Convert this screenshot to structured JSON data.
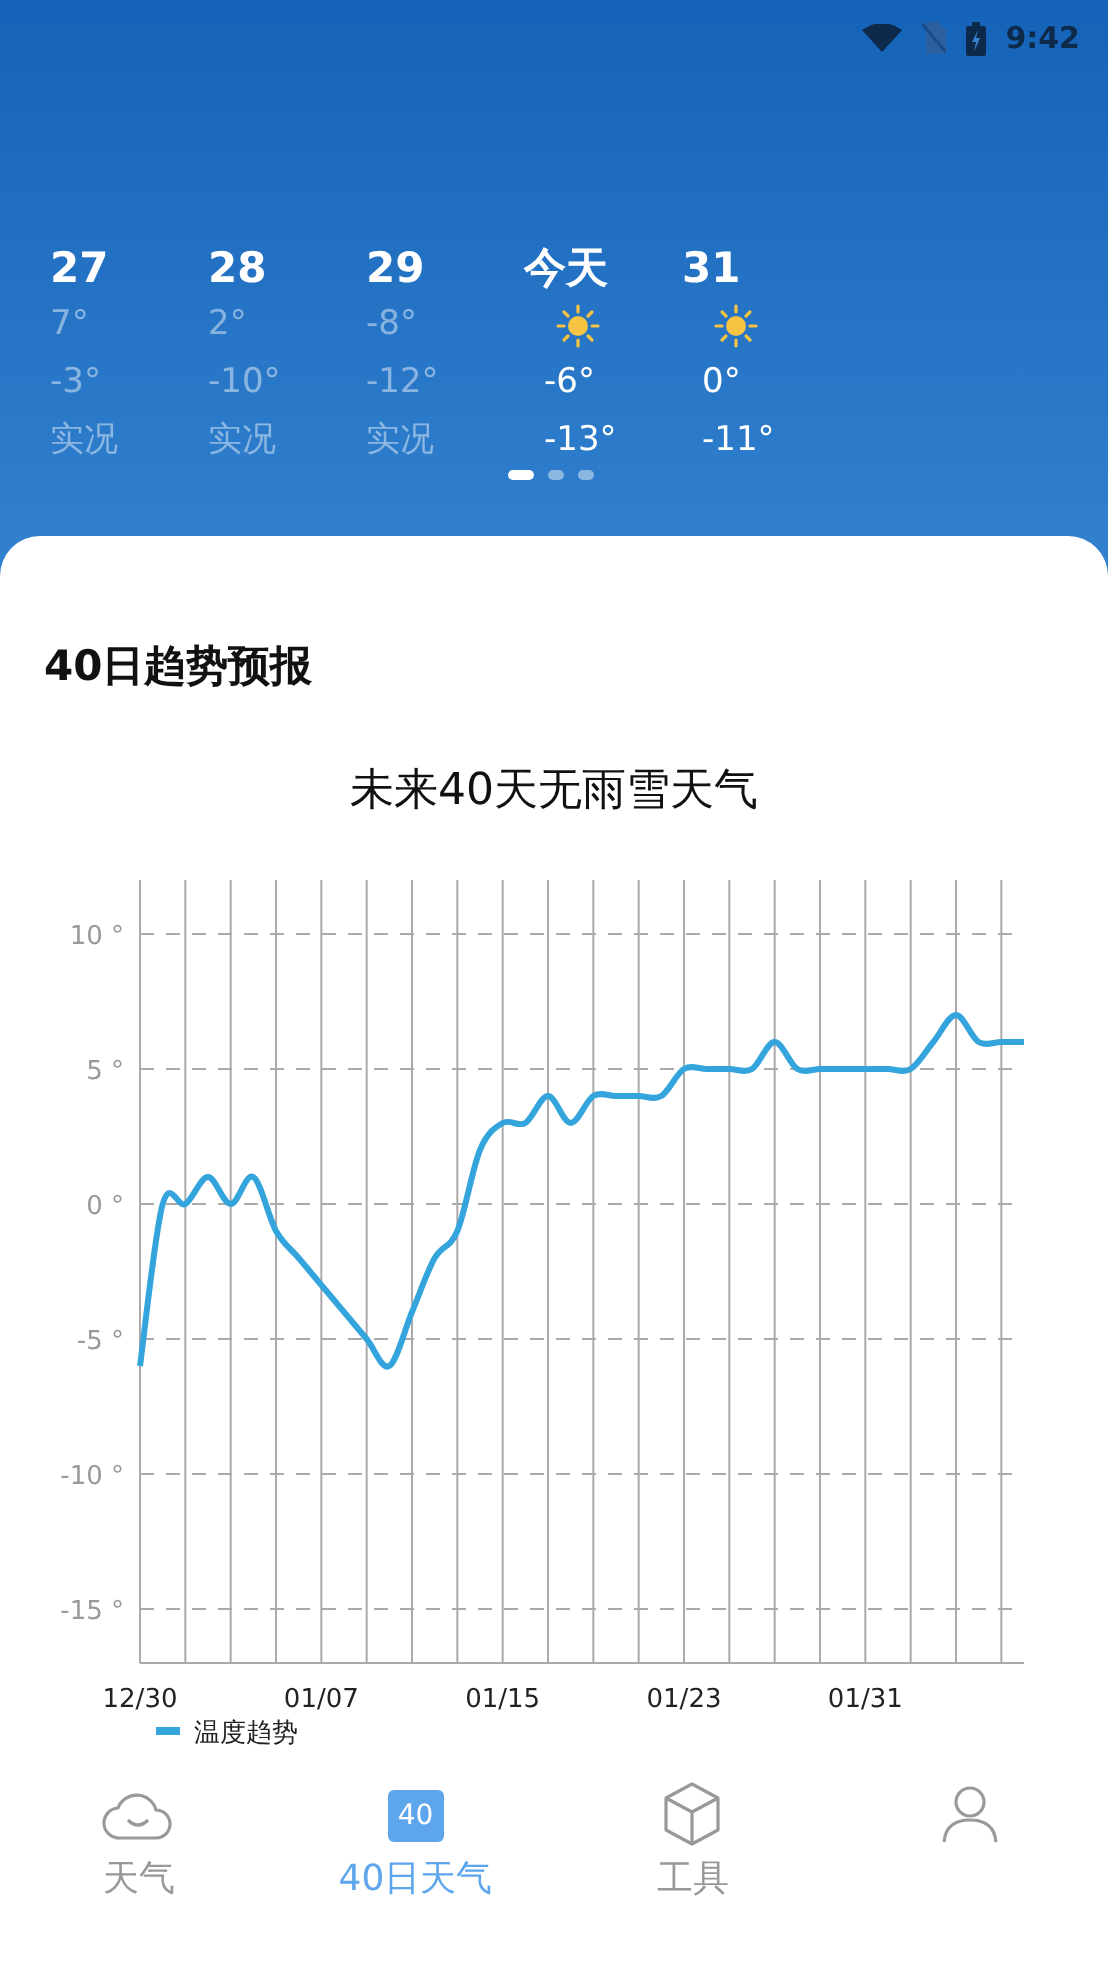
{
  "status_bar": {
    "time": "9:42"
  },
  "days": [
    {
      "label": "27",
      "kind": "observed",
      "high": "7°",
      "low": "-3°",
      "note": "实况"
    },
    {
      "label": "28",
      "kind": "observed",
      "high": "2°",
      "low": "-10°",
      "note": "实况"
    },
    {
      "label": "29",
      "kind": "observed",
      "high": "-8°",
      "low": "-12°",
      "note": "实况"
    },
    {
      "label": "今天",
      "kind": "forecast",
      "high": "-6°",
      "low": "-13°"
    },
    {
      "label": "31",
      "kind": "forecast",
      "high": "0°",
      "low": "-11°"
    }
  ],
  "pager": [
    {
      "selected": true
    },
    {
      "selected": false
    },
    {
      "selected": false
    }
  ],
  "section_title": "40日趋势预报",
  "headline": "未来40天无雨雪天气",
  "chart_data": {
    "type": "line",
    "categories": [
      "12/30",
      null,
      null,
      null,
      null,
      null,
      null,
      null,
      "01/07",
      null,
      null,
      null,
      null,
      null,
      null,
      null,
      "01/15",
      null,
      null,
      null,
      null,
      null,
      null,
      null,
      "01/23",
      null,
      null,
      null,
      null,
      null,
      null,
      null,
      "01/31",
      null,
      null,
      null,
      null,
      null,
      null,
      null
    ],
    "series": [
      {
        "name": "温度趋势",
        "color": "#34a4dc",
        "values": [
          -6,
          0,
          0,
          1,
          0,
          1,
          -1,
          -2,
          -3,
          -4,
          -5,
          -6,
          -4,
          -2,
          -1,
          2,
          3,
          3,
          4,
          3,
          4,
          4,
          4,
          4,
          5,
          5,
          5,
          5,
          6,
          5,
          5,
          5,
          5,
          5,
          5,
          6,
          7,
          6,
          6,
          6
        ]
      }
    ],
    "ylim": [
      -17,
      12
    ],
    "grid": true,
    "yticks": [
      {
        "value": 10,
        "label": "10 °"
      },
      {
        "value": 5,
        "label": "5 °"
      },
      {
        "value": 0,
        "label": "0 °"
      },
      {
        "value": -5,
        "label": "-5 °"
      },
      {
        "value": -10,
        "label": "-10 °"
      },
      {
        "value": -15,
        "label": "-15 °"
      }
    ]
  },
  "nav": [
    {
      "label": "天气",
      "kind": "weather",
      "selected": false
    },
    {
      "label": "40日天气",
      "kind": "calendar",
      "icon_text": "40",
      "selected": true
    },
    {
      "label": "工具",
      "kind": "tools",
      "selected": false
    },
    {
      "kind": "profile",
      "selected": false
    }
  ]
}
